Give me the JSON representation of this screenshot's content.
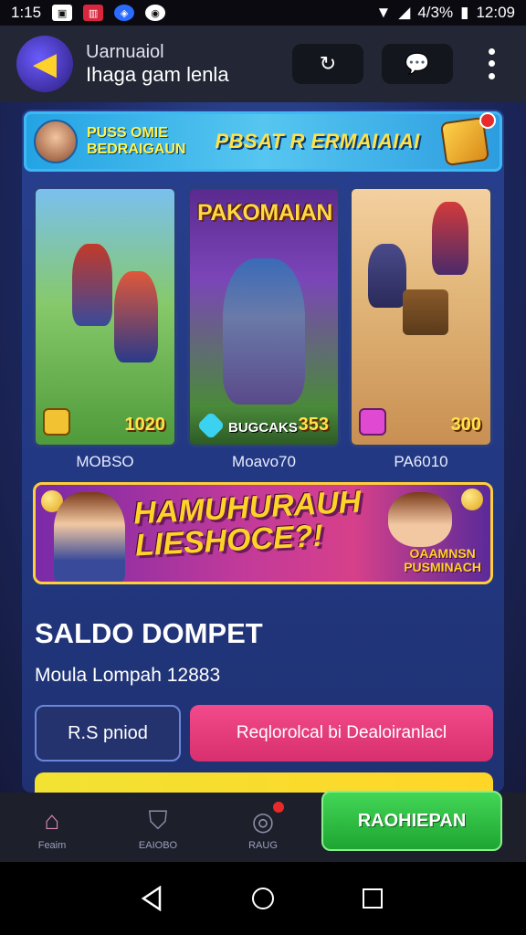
{
  "status_bar": {
    "time_left": "1:15",
    "battery": "4/3%",
    "time_right": "12:09",
    "icons": [
      "image-icon",
      "app-badge-icon",
      "browser-icon",
      "shield-icon",
      "wifi-icon",
      "signal-icon",
      "battery-icon"
    ]
  },
  "app_bar": {
    "title_line1": "Uarnuaiol",
    "title_line2": "Ihaga gam lenla",
    "refresh_icon": "refresh-icon",
    "chat_icon": "chat-icon",
    "more_icon": "more-vertical-icon"
  },
  "top_banner": {
    "left_line1": "PUSS OMIE",
    "left_line2": "BEDRAIGAUN",
    "center": "PBSAT R ERMAIAIAI"
  },
  "cards": [
    {
      "price": "1020",
      "label": "MOBSO",
      "gem_color": "#f2c232"
    },
    {
      "title_art": "PAKOMAIAN",
      "tag": "BUGCAKS",
      "price": "353",
      "label": "Moavo70",
      "gem_color": "#3ad2f0"
    },
    {
      "price": "300",
      "label": "PA6010",
      "gem_color": "#e04ad2"
    }
  ],
  "promo": {
    "headline_line1": "HAMUHURAUH",
    "headline_line2": "LIESHOCE?!",
    "side_line1": "OAAMNSN",
    "side_line2": "PUSMINACH"
  },
  "wallet": {
    "title": "SALDO DOMPET",
    "subtitle": "Moula Lompah 12883",
    "secondary_button": "R.S pniod",
    "primary_button": "Reqlorolcal bi Dealoiranlacl"
  },
  "bottom_nav": {
    "items": [
      {
        "label": "Feaim",
        "icon": "home-icon"
      },
      {
        "label": "EAIOBO",
        "icon": "wallet-icon"
      },
      {
        "label": "RAUG",
        "icon": "trophy-icon"
      }
    ],
    "cta": "RAOHIEPAN"
  },
  "colors": {
    "accent_green": "#1ea532",
    "accent_pink": "#d8306e",
    "banner_blue": "#24a3e3",
    "gold": "#ffd22a"
  }
}
